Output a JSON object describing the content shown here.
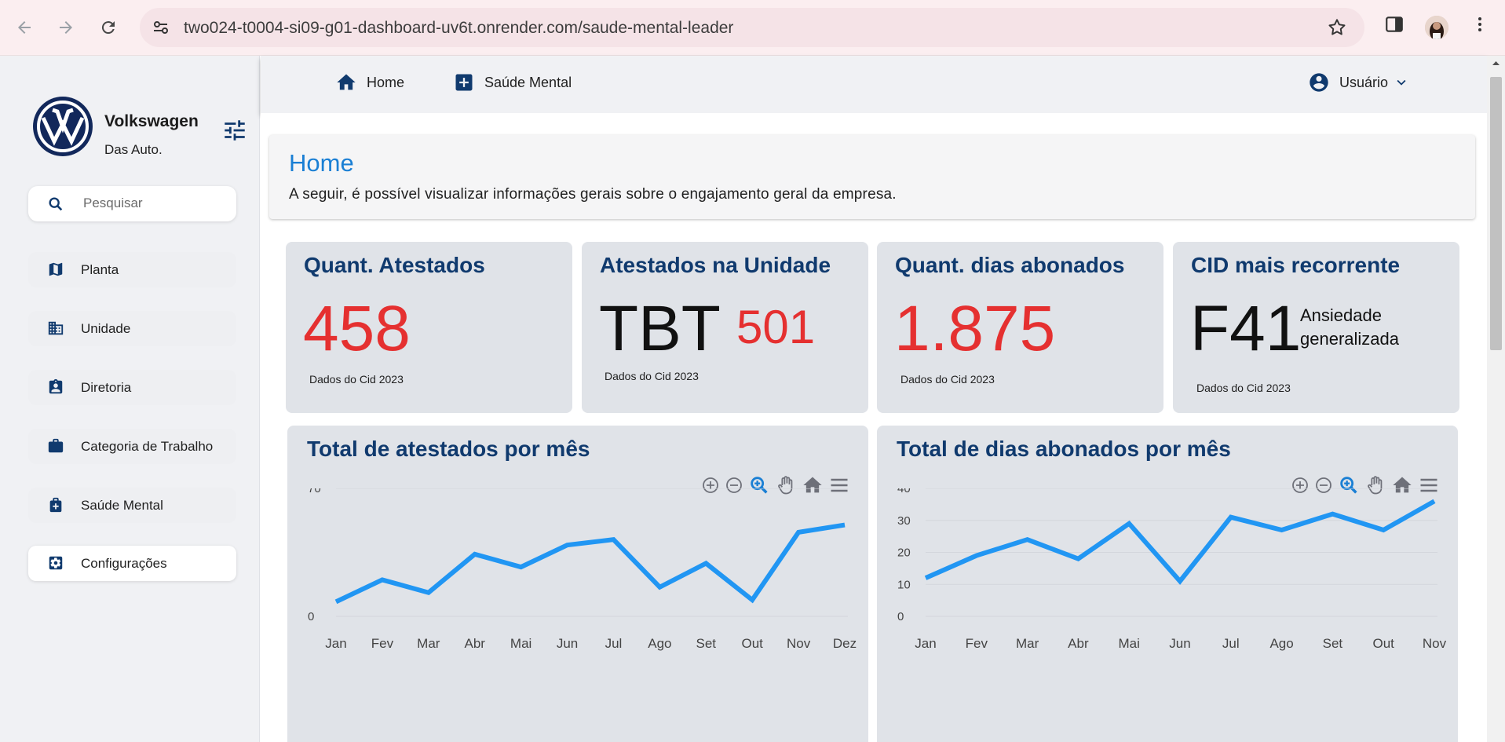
{
  "browser": {
    "url": "two024-t0004-si09-g01-dashboard-uv6t.onrender.com/saude-mental-leader"
  },
  "sidebar": {
    "brand": "Volkswagen",
    "tagline": "Das Auto.",
    "search_placeholder": "Pesquisar",
    "items": [
      {
        "label": "Planta",
        "icon": "map-icon"
      },
      {
        "label": "Unidade",
        "icon": "building-icon"
      },
      {
        "label": "Diretoria",
        "icon": "badge-icon"
      },
      {
        "label": "Categoria de Trabalho",
        "icon": "briefcase-icon"
      },
      {
        "label": "Saúde Mental",
        "icon": "medical-bag-icon"
      }
    ],
    "settings_label": "Configurações"
  },
  "topnav": {
    "home": "Home",
    "mental": "Saúde Mental",
    "user": "Usuário"
  },
  "hero": {
    "title": "Home",
    "subtitle": "A seguir, é possível visualizar informações gerais sobre o engajamento geral da empresa."
  },
  "cards": [
    {
      "title": "Quant. Atestados",
      "value": "458",
      "foot": "Dados do Cid 2023"
    },
    {
      "title": "Atestados na Unidade",
      "unit": "TBT",
      "value": "501",
      "foot": "Dados do Cid 2023"
    },
    {
      "title": "Quant. dias abonados",
      "value": "1.875",
      "foot": "Dados do Cid 2023"
    },
    {
      "title": "CID mais recorrente",
      "code": "F41",
      "desc1": "Ansiedade",
      "desc2": "generalizada",
      "foot": "Dados do Cid 2023"
    }
  ],
  "colors": {
    "accent": "#1a7fd4",
    "navy": "#103a6e",
    "red": "#e53030",
    "line": "#2196f3"
  },
  "chart_data": [
    {
      "type": "line",
      "title": "Total de atestados por mês",
      "categories": [
        "Jan",
        "Fev",
        "Mar",
        "Abr",
        "Mai",
        "Jun",
        "Jul",
        "Ago",
        "Set",
        "Out",
        "Nov",
        "Dez"
      ],
      "values": [
        8,
        20,
        13,
        34,
        27,
        39,
        42,
        16,
        29,
        9,
        46,
        50
      ],
      "ylim": [
        0,
        70
      ],
      "yticks": [
        "0",
        "70"
      ],
      "grid": true
    },
    {
      "type": "line",
      "title": "Total de dias abonados por mês",
      "categories": [
        "Jan",
        "Fev",
        "Mar",
        "Abr",
        "Mai",
        "Jun",
        "Jul",
        "Ago",
        "Set",
        "Out",
        "Nov"
      ],
      "values": [
        12,
        19,
        24,
        18,
        29,
        11,
        31,
        27,
        32,
        27,
        36
      ],
      "ylim": [
        0,
        40
      ],
      "yticks": [
        "0",
        "10",
        "20",
        "30",
        "40"
      ],
      "grid": true
    }
  ]
}
